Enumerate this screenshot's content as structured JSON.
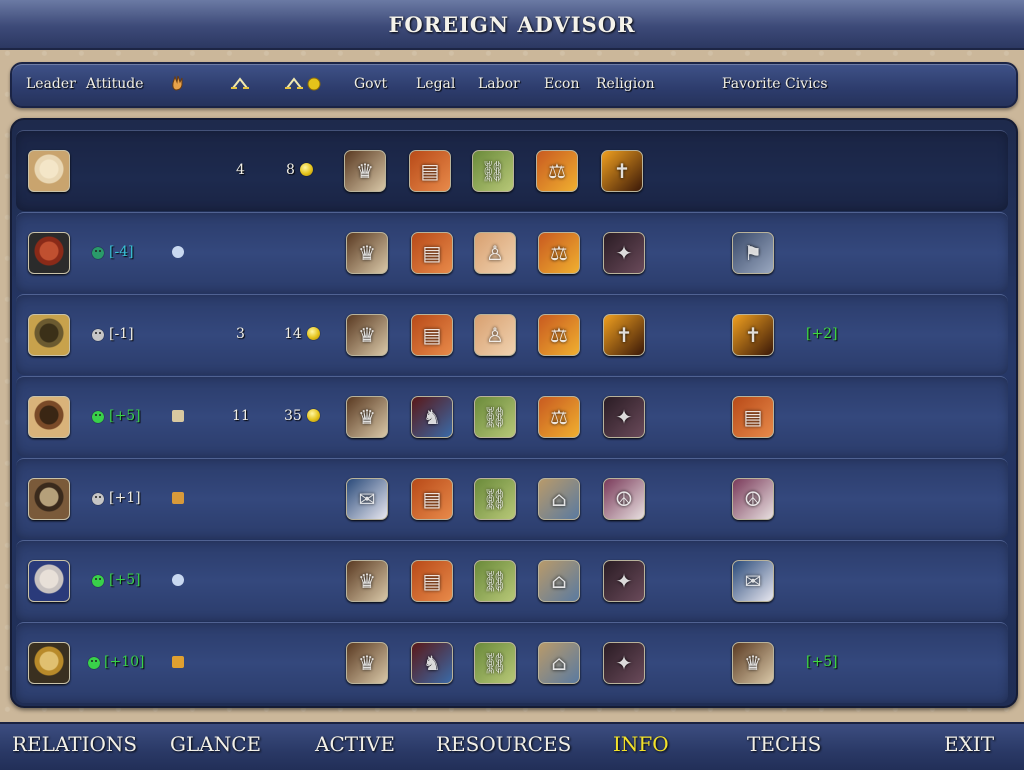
{
  "title": "FOREIGN ADVISOR",
  "columns": {
    "leader": "Leader",
    "attitude": "Attitude",
    "open_borders_icon": "hand-icon",
    "trade_icon": "trade-routes-icon",
    "trade_gold_icon": "trade-gold-icon",
    "govt": "Govt",
    "legal": "Legal",
    "labor": "Labor",
    "econ": "Econ",
    "religion": "Religion",
    "favorite": "Favorite Civics"
  },
  "rows": [
    {
      "portrait": "leader-portrait-player",
      "attitude_mood": "",
      "attitude_value": "",
      "relation_icon": "",
      "trade": "4",
      "gold": "8",
      "civics": [
        "hereditary-rule",
        "bureaucracy",
        "slavery",
        "mercantilism",
        "theocracy"
      ],
      "favorite_civic": "",
      "favorite_bonus": ""
    },
    {
      "portrait": "leader-portrait-montezuma",
      "attitude_mood": "annoyed",
      "attitude_value": "[-4]",
      "relation_icon": "star-of-david-icon",
      "trade": "",
      "gold": "",
      "civics": [
        "hereditary-rule",
        "bureaucracy",
        "caste-system",
        "mercantilism",
        "organized-religion"
      ],
      "favorite_civic": "police-state",
      "favorite_bonus": ""
    },
    {
      "portrait": "leader-portrait-huayna",
      "attitude_mood": "cautious",
      "attitude_value": "[-1]",
      "relation_icon": "",
      "trade": "3",
      "gold": "14",
      "civics": [
        "hereditary-rule",
        "bureaucracy",
        "caste-system",
        "mercantilism",
        "theocracy"
      ],
      "favorite_civic": "theocracy",
      "favorite_bonus": "[+2]"
    },
    {
      "portrait": "leader-portrait-peter",
      "attitude_mood": "pleased",
      "attitude_value": "[+5]",
      "relation_icon": "defensive-pact-icon",
      "trade": "11",
      "gold": "35",
      "civics": [
        "hereditary-rule",
        "vassalage",
        "slavery",
        "mercantilism",
        "organized-religion"
      ],
      "favorite_civic": "bureaucracy",
      "favorite_bonus": ""
    },
    {
      "portrait": "leader-portrait-mansa",
      "attitude_mood": "cautious",
      "attitude_value": "[+1]",
      "relation_icon": "shrine-icon",
      "trade": "",
      "gold": "",
      "civics": [
        "representation",
        "bureaucracy",
        "slavery",
        "free-market",
        "pacifism"
      ],
      "favorite_civic": "pacifism",
      "favorite_bonus": ""
    },
    {
      "portrait": "leader-portrait-washington",
      "attitude_mood": "pleased",
      "attitude_value": "[+5]",
      "relation_icon": "star-of-david-icon",
      "trade": "",
      "gold": "",
      "civics": [
        "hereditary-rule",
        "bureaucracy",
        "slavery",
        "free-market",
        "organized-religion"
      ],
      "favorite_civic": "representation",
      "favorite_bonus": ""
    },
    {
      "portrait": "leader-portrait-hatshepsut",
      "attitude_mood": "friendly",
      "attitude_value": "[+10]",
      "relation_icon": "hindu-shrine-icon",
      "trade": "",
      "gold": "",
      "civics": [
        "hereditary-rule",
        "vassalage",
        "slavery",
        "free-market",
        "organized-religion"
      ],
      "favorite_civic": "hereditary-rule",
      "favorite_bonus": "[+5]"
    }
  ],
  "nav": [
    "RELATIONS",
    "GLANCE",
    "ACTIVE",
    "RESOURCES",
    "INFO",
    "TECHS",
    "EXIT"
  ],
  "nav_active": "INFO",
  "colors": {
    "accent_active": "#f3e22a",
    "attitude_pleased": "#39d14a",
    "attitude_annoyed": "#2fae6a",
    "attitude_cautious": "#c9c9c9",
    "bonus_text": "#3fdc3f",
    "negative_text": "#39c2d6"
  }
}
